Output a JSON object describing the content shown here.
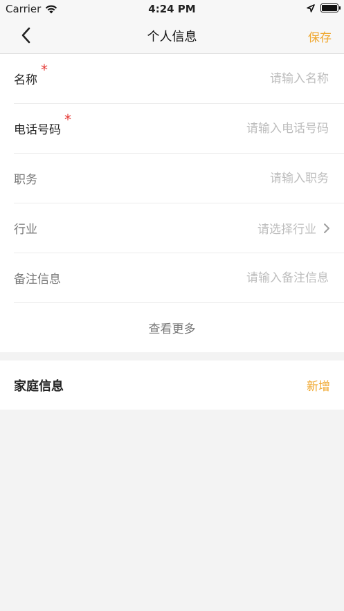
{
  "status_bar": {
    "carrier": "Carrier",
    "time": "4:24 PM"
  },
  "nav": {
    "title": "个人信息",
    "save_label": "保存"
  },
  "form": {
    "name": {
      "label": "名称",
      "placeholder": "请输入名称",
      "required_mark": "*"
    },
    "phone": {
      "label": "电话号码",
      "placeholder": "请输入电话号码",
      "required_mark": "*"
    },
    "position": {
      "label": "职务",
      "placeholder": "请输入职务"
    },
    "industry": {
      "label": "行业",
      "placeholder": "请选择行业"
    },
    "notes": {
      "label": "备注信息",
      "placeholder": "请输入备注信息"
    },
    "view_more": "查看更多"
  },
  "family": {
    "title": "家庭信息",
    "add_label": "新增"
  },
  "colors": {
    "accent": "#f0a830",
    "required": "#e53935",
    "placeholder": "#bdbdbd"
  }
}
